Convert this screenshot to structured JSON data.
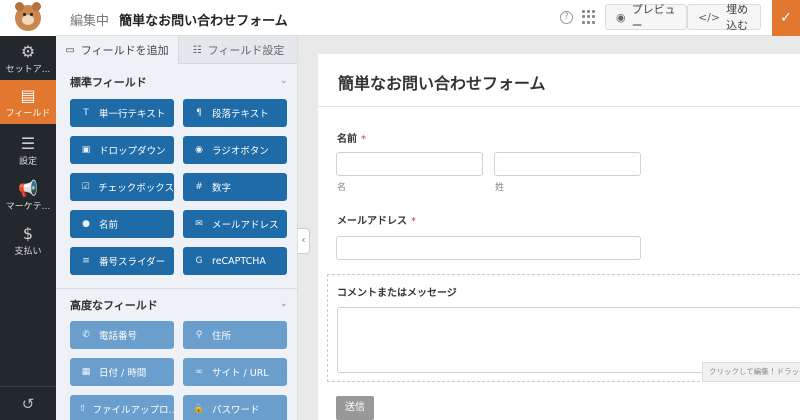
{
  "header": {
    "title_prefix": "編集中",
    "form_name": "簡単なお問い合わせフォーム",
    "help_icon": "question-circle-icon",
    "preview_label": "プレビュー",
    "embed_label": "埋め込む",
    "save_icon": "check-icon",
    "accent_color": "#e27730"
  },
  "leftnav": {
    "items": [
      {
        "label": "セットア...",
        "icon": "gear-icon"
      },
      {
        "label": "フィールド",
        "icon": "fields-icon"
      },
      {
        "label": "設定",
        "icon": "sliders-icon"
      },
      {
        "label": "マーケテ...",
        "icon": "megaphone-icon"
      },
      {
        "label": "支払い",
        "icon": "dollar-icon"
      }
    ],
    "undo_icon": "history-icon"
  },
  "panel": {
    "tabs": [
      "フィールドを追加",
      "フィールド設定"
    ],
    "standard": {
      "title": "標準フィールド",
      "fields": [
        {
          "label": "単一行テキスト",
          "icon": "text-icon"
        },
        {
          "label": "段落テキスト",
          "icon": "paragraph-icon"
        },
        {
          "label": "ドロップダウン",
          "icon": "dropdown-icon"
        },
        {
          "label": "ラジオボタン",
          "icon": "radio-icon"
        },
        {
          "label": "チェックボックス",
          "icon": "checkbox-icon"
        },
        {
          "label": "数字",
          "icon": "hash-icon"
        },
        {
          "label": "名前",
          "icon": "user-icon"
        },
        {
          "label": "メールアドレス",
          "icon": "envelope-icon"
        },
        {
          "label": "番号スライダー",
          "icon": "slider-icon"
        },
        {
          "label": "reCAPTCHA",
          "icon": "google-icon"
        }
      ]
    },
    "advanced": {
      "title": "高度なフィールド",
      "fields": [
        {
          "label": "電話番号",
          "icon": "phone-icon"
        },
        {
          "label": "住所",
          "icon": "map-pin-icon"
        },
        {
          "label": "日付 / 時間",
          "icon": "calendar-icon"
        },
        {
          "label": "サイト / URL",
          "icon": "link-icon"
        },
        {
          "label": "ファイルアップロ...",
          "icon": "upload-icon"
        },
        {
          "label": "パスワード",
          "icon": "lock-icon"
        }
      ]
    }
  },
  "form": {
    "title": "簡単なお問い合わせフォーム",
    "name_label": "名前",
    "required_mark": "*",
    "first_sublabel": "名",
    "last_sublabel": "姓",
    "email_label": "メールアドレス",
    "comment_label": "コメントまたはメッセージ",
    "edit_hint": "クリックして編集 ! ドラッグし",
    "submit_label": "送信"
  }
}
